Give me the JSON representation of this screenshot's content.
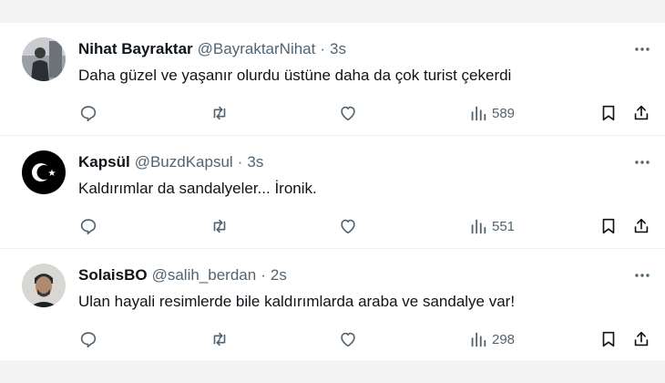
{
  "tweets": [
    {
      "name": "Nihat Bayraktar",
      "handle": "@BayraktarNihat",
      "separator": "·",
      "time": "3s",
      "text": "Daha güzel ve yaşanır olurdu üstüne daha da çok turist çekerdi",
      "views": "589",
      "avatar_icon": "person-photo-avatar"
    },
    {
      "name": "Kapsül",
      "handle": "@BuzdKapsul",
      "separator": "·",
      "time": "3s",
      "text": "Kaldırımlar da sandalyeler...  İronik.",
      "views": "551",
      "avatar_icon": "crescent-star-avatar"
    },
    {
      "name": "SolaisBO",
      "handle": "@salih_berdan",
      "separator": "·",
      "time": "2s",
      "text": "Ulan hayali resimlerde bile kaldırımlarda araba ve sandalye var!",
      "views": "298",
      "avatar_icon": "person-photo-avatar"
    }
  ],
  "icons": {
    "more": "more-icon",
    "reply": "reply-icon",
    "retweet": "retweet-icon",
    "like": "like-icon",
    "views": "views-icon",
    "bookmark": "bookmark-icon",
    "share": "share-icon"
  },
  "colors": {
    "text": "#0f1419",
    "muted": "#536471",
    "divider": "#eff3f4",
    "frame": "#f3f3f3"
  }
}
